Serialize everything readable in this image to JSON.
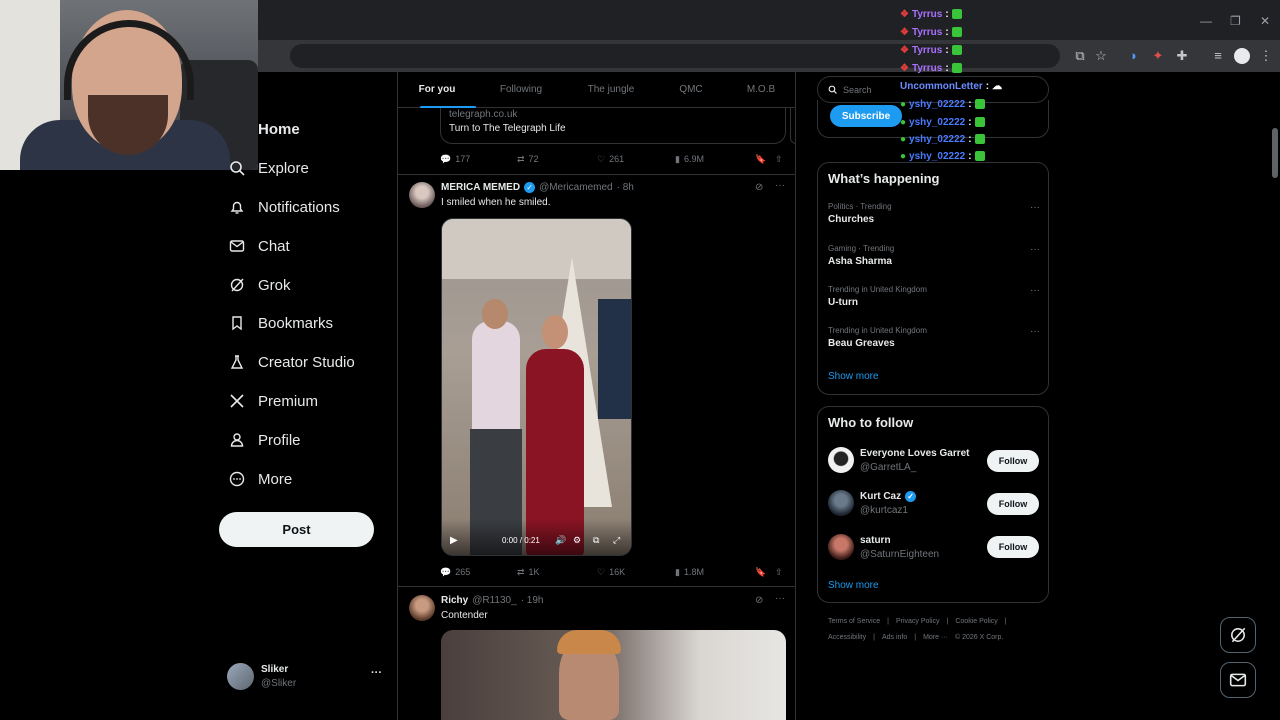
{
  "browser": {
    "minimize": "—",
    "restore": "❐",
    "close": "✕"
  },
  "nav": {
    "items": [
      {
        "label": "Home",
        "icon": "home-icon"
      },
      {
        "label": "Explore",
        "icon": "search-icon"
      },
      {
        "label": "Notifications",
        "icon": "bell-icon"
      },
      {
        "label": "Chat",
        "icon": "mail-icon"
      },
      {
        "label": "Grok",
        "icon": "grok-icon"
      },
      {
        "label": "Bookmarks",
        "icon": "bookmark-icon"
      },
      {
        "label": "Creator Studio",
        "icon": "flask-icon"
      },
      {
        "label": "Premium",
        "icon": "x-logo-icon"
      },
      {
        "label": "Profile",
        "icon": "person-icon"
      },
      {
        "label": "More",
        "icon": "more-circle-icon"
      }
    ],
    "post_label": "Post",
    "account": {
      "name": "Sliker",
      "handle": "@Sliker",
      "more": "···"
    }
  },
  "feed": {
    "tabs": [
      "For you",
      "Following",
      "The jungle",
      "QMC",
      "M.O.B"
    ],
    "card": {
      "domain": "telegraph.co.uk",
      "title": "Turn to The Telegraph Life"
    },
    "top_actions": {
      "replies": "177",
      "reposts": "72",
      "likes": "261",
      "views": "6.9M"
    },
    "tweet1": {
      "name": "MERICA MEMED",
      "handle": "@Mericamemed",
      "time": "· 8h",
      "text": "I smiled when he smiled.",
      "video_time": "0:00 / 0:21",
      "replies": "265",
      "reposts": "1K",
      "likes": "16K",
      "views": "1.8M"
    },
    "tweet2": {
      "name": "Richy",
      "handle": "@R1130_",
      "time": "· 19h",
      "text": "Contender"
    }
  },
  "right": {
    "search_placeholder": "Search",
    "subscribe": "Subscribe",
    "happening_title": "What’s happening",
    "trends": [
      {
        "cat": "Politics · Trending",
        "name": "Churches"
      },
      {
        "cat": "Gaming · Trending",
        "name": "Asha Sharma"
      },
      {
        "cat": "Trending in United Kingdom",
        "name": "U-turn"
      },
      {
        "cat": "Trending in United Kingdom",
        "name": "Beau Greaves"
      }
    ],
    "show_more": "Show more",
    "who_title": "Who to follow",
    "who": [
      {
        "name": "Everyone Loves Garret",
        "handle": "@GarretLA_",
        "verified": false
      },
      {
        "name": "Kurt Caz",
        "handle": "@kurtcaz1",
        "verified": true
      },
      {
        "name": "saturn",
        "handle": "@SaturnEighteen",
        "verified": false
      }
    ],
    "follow": "Follow",
    "footer": {
      "line1": [
        "Terms of Service",
        "|",
        "Privacy Policy",
        "|",
        "Cookie Policy",
        "|"
      ],
      "line2": [
        "Accessibility",
        "|",
        "Ads info",
        "|",
        "More ···",
        "©  2026 X Corp."
      ]
    }
  },
  "chat_overlay": [
    {
      "user": "Tyrrus",
      "sep": ":",
      "color": "#a970ff"
    },
    {
      "user": "Tyrrus",
      "sep": ":",
      "color": "#a970ff"
    },
    {
      "user": "Tyrrus",
      "sep": ":",
      "color": "#a970ff"
    },
    {
      "user": "Tyrrus",
      "sep": ":",
      "color": "#a970ff"
    },
    {
      "user": "UncommonLetter",
      "sep": ":",
      "color": "#6b8cff"
    },
    {
      "user": "yshy_02222",
      "sep": ":",
      "color": "#4b7bff"
    },
    {
      "user": "yshy_02222",
      "sep": ":",
      "color": "#4b7bff"
    },
    {
      "user": "yshy_02222",
      "sep": ":",
      "color": "#4b7bff"
    },
    {
      "user": "yshy_02222",
      "sep": ":",
      "color": "#4b7bff"
    }
  ],
  "colors": {
    "accent": "#1d9bf0",
    "bg": "#000000",
    "border": "#2f3336",
    "muted": "#71767b"
  }
}
